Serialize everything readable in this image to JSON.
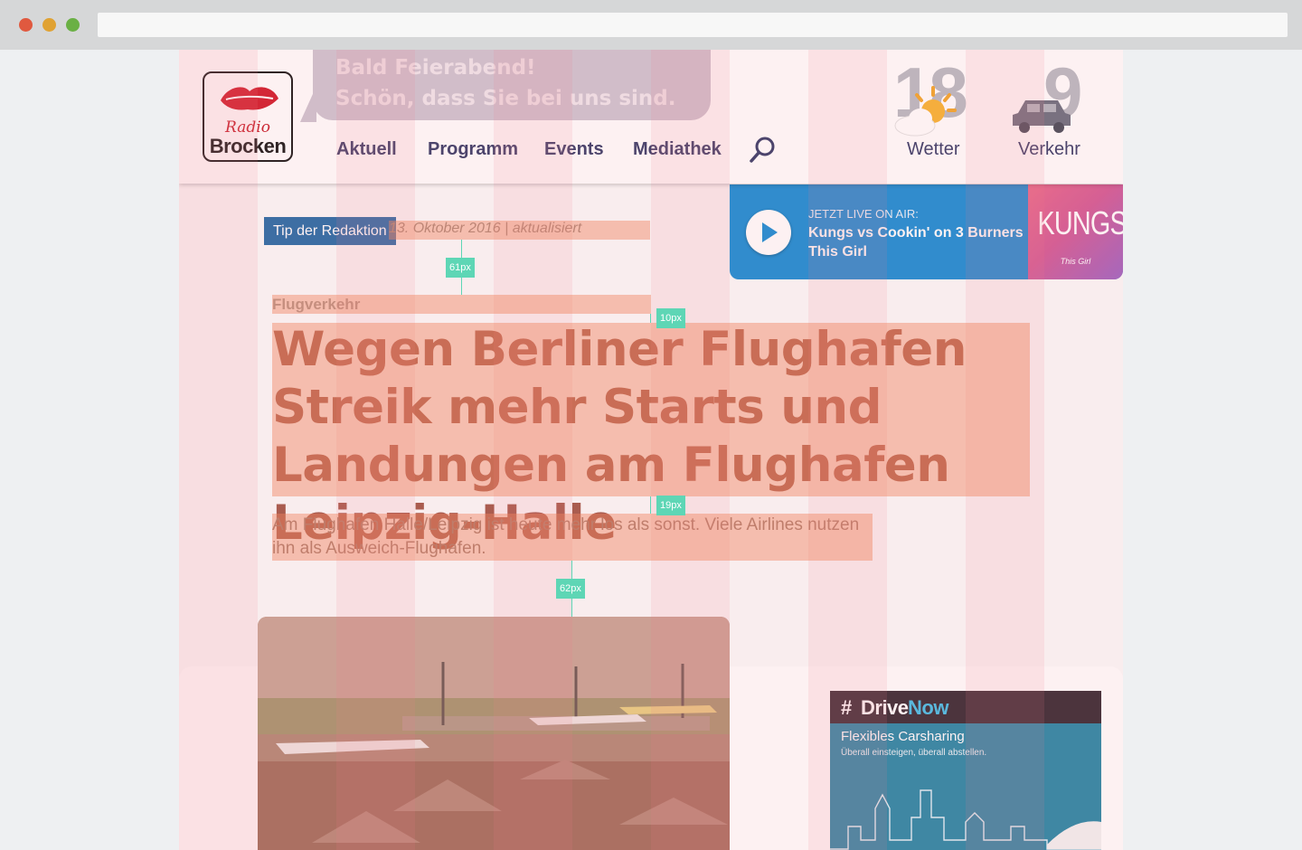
{
  "header": {
    "logo_radio": "Radio",
    "logo_brocken": "Brocken",
    "greeting_line1": "Bald Feierabend!",
    "greeting_line2": "Schön, dass Sie bei uns sind.",
    "nav": [
      "Aktuell",
      "Programm",
      "Events",
      "Mediathek"
    ],
    "weather_temp": "18",
    "weather_label": "Wetter",
    "traffic_count": "9",
    "traffic_label": "Verkehr"
  },
  "player": {
    "live_label": "JETZT LIVE ON AIR:",
    "track_line1": "Kungs vs Cookin' on 3 Burners",
    "track_line2": "This Girl",
    "cover_title": "KUNGS",
    "cover_subtitle": "This Girl"
  },
  "article": {
    "tag": "Tip der Redaktion",
    "date": "13. Oktober 2016 | aktualisiert",
    "kicker": "Flugverkehr",
    "headline": "Wegen Berliner Flughafen Streik mehr Starts und Landungen am Flughafen Leipzig-Halle",
    "teaser": "Am Flughafen Halle/Leipzig ist heute mehr los als sonst. Viele Airlines nutzen ihn als Ausweich-Flughafen."
  },
  "ad": {
    "logo_hash": "#",
    "logo_drive": "Drive",
    "logo_now": "Now",
    "headline": "Flexibles Carsharing",
    "subline": "Überall einsteigen, überall abstellen."
  },
  "spacing": {
    "date_to_kicker": "61px",
    "kicker_to_headline": "10px",
    "headline_to_teaser": "19px",
    "teaser_to_image": "62px"
  },
  "colors": {
    "nav_text": "#3a3f6a",
    "tag_bg": "#2a6ea8",
    "player_bg": "#1c8fd6",
    "grid_overlay": "#eb7882",
    "spacing_badge": "#5ed6b5"
  }
}
